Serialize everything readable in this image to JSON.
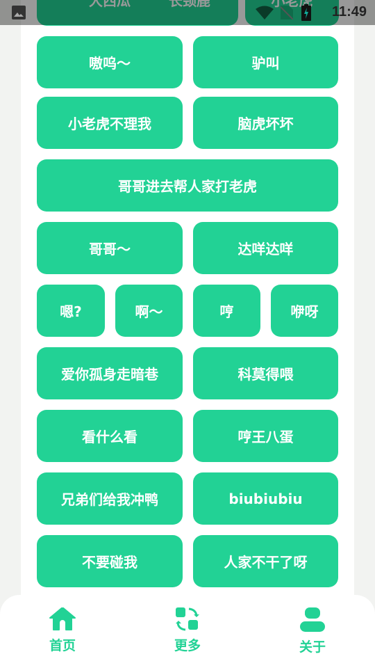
{
  "status_bar": {
    "time": "11:49",
    "icons": [
      "gallery-icon",
      "wifi-icon",
      "no-sim-icon",
      "battery-charging-icon"
    ]
  },
  "accent_color": "#22d295",
  "buttons": [
    "大西瓜",
    "长颈鹿",
    "小老虎",
    "嗷呜～",
    "驴叫",
    "小老虎不理我",
    "脑虎坏坏",
    "哥哥进去帮人家打老虎",
    "哥哥～",
    "达咩达咩",
    "嗯?",
    "啊～",
    "哼",
    "咿呀",
    "爱你孤身走暗巷",
    "科莫得喂",
    "看什么看",
    "哼王八蛋",
    "兄弟们给我冲鸭",
    "biubiubiu",
    "不要碰我",
    "人家不干了呀"
  ],
  "nav": [
    {
      "label": "首页",
      "icon": "home-icon"
    },
    {
      "label": "更多",
      "icon": "swap-icon"
    },
    {
      "label": "关于",
      "icon": "person-icon"
    }
  ]
}
